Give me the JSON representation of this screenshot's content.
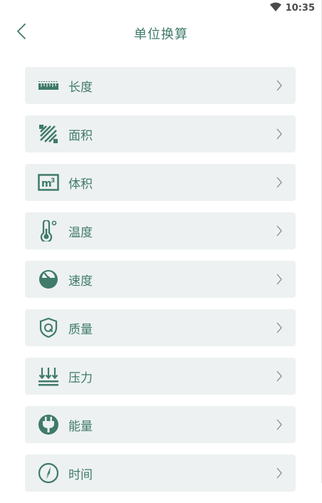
{
  "status_bar": {
    "time": "10:35",
    "icons": [
      "wifi-icon"
    ]
  },
  "header": {
    "title": "单位换算",
    "back_icon": "chevron-left-icon"
  },
  "theme": {
    "accent": "#3f7a6b",
    "item_bg": "#edf1f1"
  },
  "items": [
    {
      "label": "长度",
      "icon": "ruler-icon"
    },
    {
      "label": "面积",
      "icon": "area-icon"
    },
    {
      "label": "体积",
      "icon": "cubic-meter-icon"
    },
    {
      "label": "温度",
      "icon": "thermometer-icon"
    },
    {
      "label": "速度",
      "icon": "speedometer-icon"
    },
    {
      "label": "质量",
      "icon": "shield-q-icon"
    },
    {
      "label": "压力",
      "icon": "pressure-icon"
    },
    {
      "label": "能量",
      "icon": "plug-icon"
    },
    {
      "label": "时间",
      "icon": "compass-icon"
    }
  ]
}
